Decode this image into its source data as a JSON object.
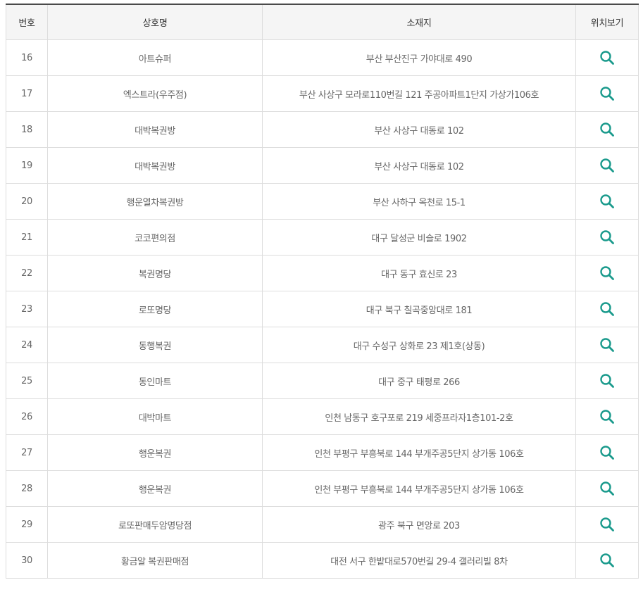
{
  "table": {
    "headers": [
      "번호",
      "상호명",
      "소재지",
      "위치보기"
    ],
    "rows": [
      {
        "no": "16",
        "name": "아트슈퍼",
        "addr": "부산 부산진구 가야대로 490"
      },
      {
        "no": "17",
        "name": "엑스트라(우주점)",
        "addr": "부산 사상구 모라로110번길 121 주공아파트1단지 가상가106호"
      },
      {
        "no": "18",
        "name": "대박복권방",
        "addr": "부산 사상구 대동로 102"
      },
      {
        "no": "19",
        "name": "대박복권방",
        "addr": "부산 사상구 대동로 102"
      },
      {
        "no": "20",
        "name": "행운열차복권방",
        "addr": "부산 사하구 옥천로 15-1"
      },
      {
        "no": "21",
        "name": "코코편의점",
        "addr": "대구 달성군 비슬로 1902"
      },
      {
        "no": "22",
        "name": "복권명당",
        "addr": "대구 동구 효신로 23"
      },
      {
        "no": "23",
        "name": "로또명당",
        "addr": "대구 북구 칠곡중앙대로 181"
      },
      {
        "no": "24",
        "name": "동행복권",
        "addr": "대구 수성구 상화로 23 제1호(상동)"
      },
      {
        "no": "25",
        "name": "동인마트",
        "addr": "대구 중구 태평로 266"
      },
      {
        "no": "26",
        "name": "대박마트",
        "addr": "인천 남동구 호구포로 219 세중프라자1층101-2호"
      },
      {
        "no": "27",
        "name": "행운복권",
        "addr": "인천 부평구 부흥북로 144 부개주공5단지 상가동 106호"
      },
      {
        "no": "28",
        "name": "행운복권",
        "addr": "인천 부평구 부흥북로 144 부개주공5단지 상가동 106호"
      },
      {
        "no": "29",
        "name": "로또판매두암명당점",
        "addr": "광주 북구 면앙로 203"
      },
      {
        "no": "30",
        "name": "황금알 복권판매점",
        "addr": "대전 서구 한밭대로570번길 29-4 갤러리빌 8차"
      }
    ],
    "location_icon": "magnifier-icon"
  },
  "colors": {
    "icon": "#1a9a8c",
    "header_bg": "#f5f5f5",
    "border": "#dddddd",
    "top_border": "#4a4a4a"
  }
}
